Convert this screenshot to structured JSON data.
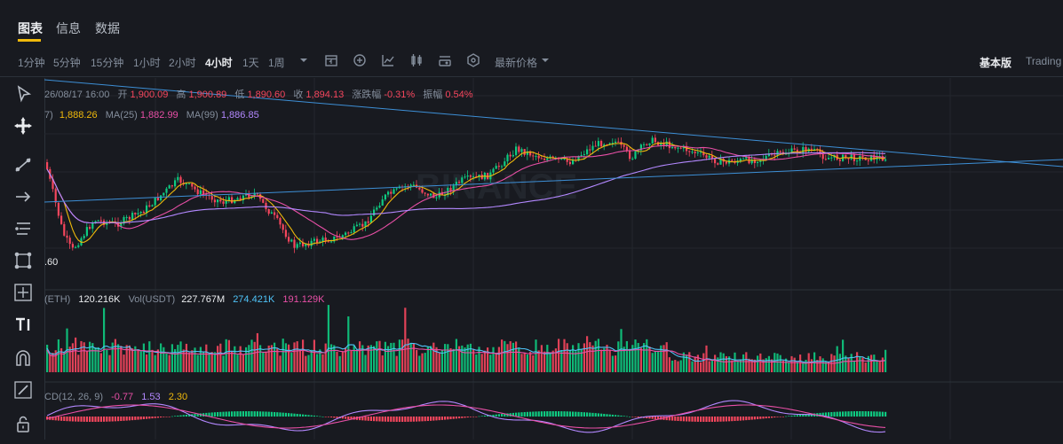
{
  "tabs": [
    "图表",
    "信息",
    "数据"
  ],
  "intervals": [
    "1分钟",
    "5分钟",
    "15分钟",
    "1小时",
    "2小时",
    "4小时",
    "1天",
    "1周"
  ],
  "active_interval": "4小时",
  "price_mode": "最新价格",
  "view_modes": {
    "basic": "基本版",
    "tradingview": "Trading"
  },
  "ohlc": {
    "date": "26/08/17 16:00",
    "open_label": "开",
    "open": "1,900.09",
    "high_label": "高",
    "high": "1,900.89",
    "low_label": "低",
    "low": "1,890.60",
    "close_label": "收",
    "close": "1,894.13",
    "change_label": "涨跌幅",
    "change": "-0.31%",
    "amplitude_label": "振幅",
    "amplitude": "0.54%"
  },
  "ma": {
    "prefix": "7)",
    "ma7": "1,888.26",
    "ma25_label": "MA(25)",
    "ma25": "1,882.99",
    "ma99_label": "MA(99)",
    "ma99": "1,886.85"
  },
  "price_marks": {
    "top": "5",
    "low": ".60"
  },
  "volume": {
    "prefix": "(ETH)",
    "eth": "120.216K",
    "usdt_label": "Vol(USDT)",
    "usdt": "227.767M",
    "ma1": "274.421K",
    "ma2": "191.129K"
  },
  "macd": {
    "prefix": "CD(12, 26, 9)",
    "macd": "-0.77",
    "dif": "1.53",
    "dea": "2.30"
  },
  "watermark": "BINANCE",
  "colors": {
    "up": "#0ecb81",
    "down": "#f6465d",
    "ma7": "#f0b90b",
    "ma25": "#e84fa6",
    "ma99": "#b388ff",
    "trend": "#3d8fd6",
    "accent": "#f0b90b"
  },
  "left_tool_icons": [
    "cursor-icon",
    "crosshair-icon",
    "trendline-icon",
    "arrow-icon",
    "fib-icon",
    "pattern-icon",
    "measure-icon",
    "text-icon",
    "magnet-icon",
    "pencil-icon",
    "lock-icon"
  ]
}
